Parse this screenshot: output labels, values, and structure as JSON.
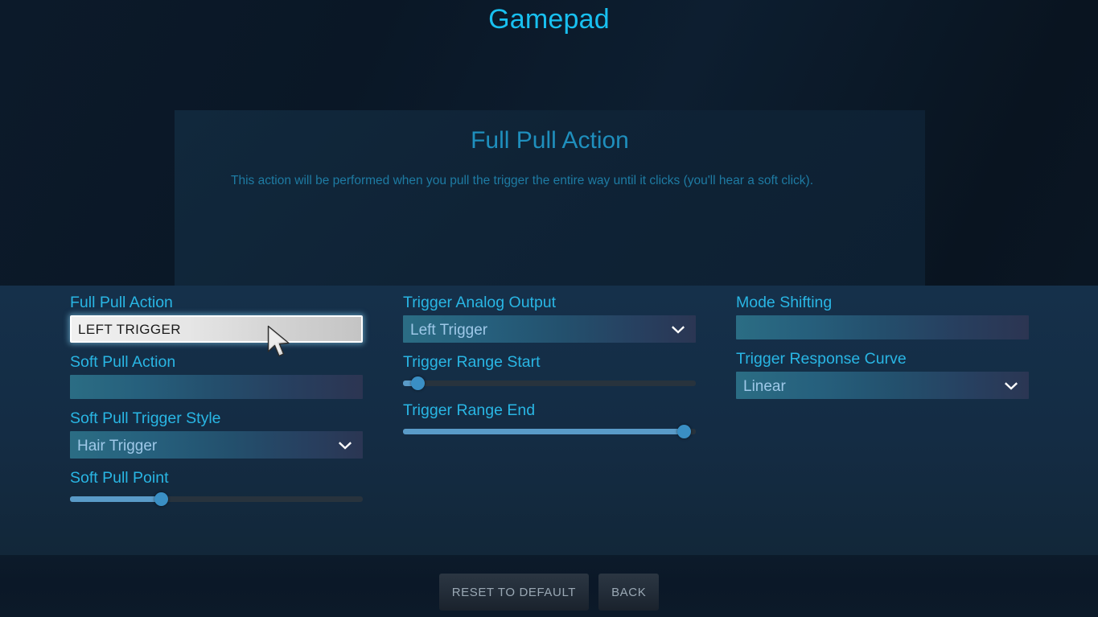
{
  "header": {
    "title": "Gamepad"
  },
  "detail_panel": {
    "title": "Full Pull Action",
    "description": "This action will be performed when you pull the trigger the entire way until it clicks (you'll hear a soft click)."
  },
  "columns": {
    "left": {
      "full_pull_action": {
        "label": "Full Pull Action",
        "value": "LEFT TRIGGER",
        "selected": true
      },
      "soft_pull_action": {
        "label": "Soft Pull Action",
        "value": ""
      },
      "soft_pull_trigger_style": {
        "label": "Soft Pull Trigger Style",
        "value": "Hair Trigger"
      },
      "soft_pull_point": {
        "label": "Soft Pull Point",
        "value": 31
      }
    },
    "middle": {
      "trigger_analog_output": {
        "label": "Trigger Analog Output",
        "value": "Left Trigger"
      },
      "trigger_range_start": {
        "label": "Trigger Range Start",
        "value": 5
      },
      "trigger_range_end": {
        "label": "Trigger Range End",
        "value": 96
      }
    },
    "right": {
      "mode_shifting": {
        "label": "Mode Shifting",
        "value": ""
      },
      "trigger_response_curve": {
        "label": "Trigger Response Curve",
        "value": "Linear"
      }
    }
  },
  "footer": {
    "reset_label": "RESET TO DEFAULT",
    "back_label": "BACK"
  },
  "icons": {
    "chevron_down": "chevron-down-icon",
    "cursor": "mouse-pointer-icon"
  },
  "colors": {
    "accent_cyan": "#29b6e4",
    "title_cyan": "#18c0f0",
    "panel_title": "#1f8fbd",
    "description": "#1e7ba3",
    "slider_fill": "#5a9bc8",
    "slider_knob": "#3a8fc4",
    "slider_track": "#28333d",
    "background": "#0c1a2a",
    "panel_background": "#11283c",
    "settings_background": "#15304a"
  }
}
